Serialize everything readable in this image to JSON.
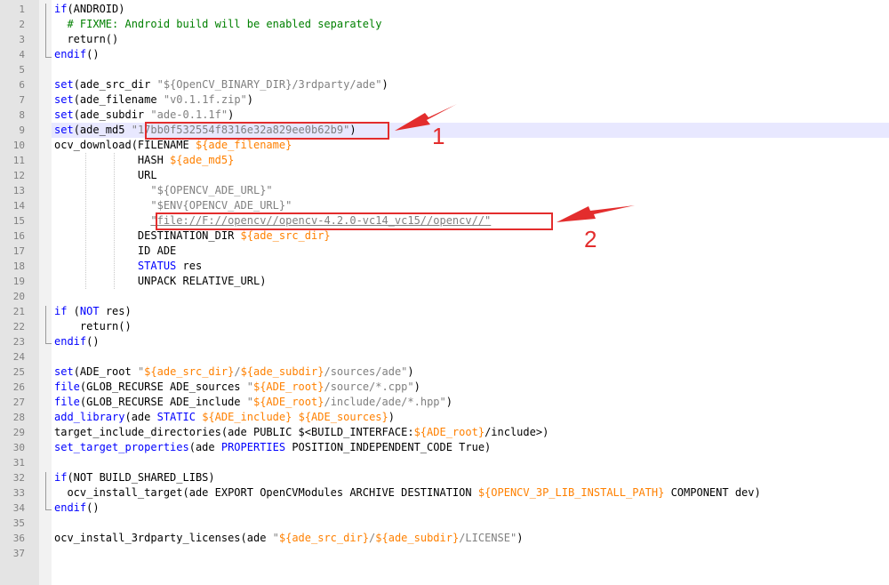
{
  "editor": {
    "line_numbers": [
      "1",
      "2",
      "3",
      "4",
      "5",
      "6",
      "7",
      "8",
      "9",
      "10",
      "11",
      "12",
      "13",
      "14",
      "15",
      "16",
      "17",
      "18",
      "19",
      "20",
      "21",
      "22",
      "23",
      "24",
      "25",
      "26",
      "27",
      "28",
      "29",
      "30",
      "31",
      "32",
      "33",
      "34",
      "35",
      "36",
      "37"
    ],
    "lines": [
      [
        {
          "t": "if",
          "c": "kw"
        },
        {
          "t": "(ANDROID)"
        }
      ],
      [
        {
          "t": "  # FIXME: Android build will be enabled separately",
          "c": "cm"
        }
      ],
      [
        {
          "t": "  return()"
        }
      ],
      [
        {
          "t": "endif",
          "c": "kw"
        },
        {
          "t": "()"
        }
      ],
      [],
      [
        {
          "t": "set",
          "c": "kw"
        },
        {
          "t": "(ade_src_dir "
        },
        {
          "t": "\"${OpenCV_BINARY_DIR}/3rdparty/ade\"",
          "c": "str"
        },
        {
          "t": ")"
        }
      ],
      [
        {
          "t": "set",
          "c": "kw"
        },
        {
          "t": "(ade_filename "
        },
        {
          "t": "\"v0.1.1f.zip\"",
          "c": "str"
        },
        {
          "t": ")"
        }
      ],
      [
        {
          "t": "set",
          "c": "kw"
        },
        {
          "t": "(ade_subdir "
        },
        {
          "t": "\"ade-0.1.1f\"",
          "c": "str"
        },
        {
          "t": ")"
        }
      ],
      [
        {
          "t": "set",
          "c": "kw"
        },
        {
          "t": "(ade_md5 "
        },
        {
          "t": "\"17bb0f532554f8316e32a829ee0b62b9\"",
          "c": "str"
        },
        {
          "t": ")"
        }
      ],
      [
        {
          "t": "ocv_download(FILENAME "
        },
        {
          "t": "${ade_filename}",
          "c": "var"
        }
      ],
      [
        {
          "t": "             HASH "
        },
        {
          "t": "${ade_md5}",
          "c": "var"
        }
      ],
      [
        {
          "t": "             URL"
        }
      ],
      [
        {
          "t": "               "
        },
        {
          "t": "\"${OPENCV_ADE_URL}\"",
          "c": "str"
        }
      ],
      [
        {
          "t": "               "
        },
        {
          "t": "\"$ENV{OPENCV_ADE_URL}\"",
          "c": "str"
        }
      ],
      [
        {
          "t": "               "
        },
        {
          "t": "\"file://F://opencv//opencv-4.2.0-vc14_vc15//opencv//\"",
          "c": "str ul"
        }
      ],
      [
        {
          "t": "             DESTINATION_DIR "
        },
        {
          "t": "${ade_src_dir}",
          "c": "var"
        }
      ],
      [
        {
          "t": "             ID ADE"
        }
      ],
      [
        {
          "t": "             "
        },
        {
          "t": "STATUS",
          "c": "kw"
        },
        {
          "t": " res"
        }
      ],
      [
        {
          "t": "             UNPACK RELATIVE_URL)"
        }
      ],
      [],
      [
        {
          "t": "if",
          "c": "kw"
        },
        {
          "t": " ("
        },
        {
          "t": "NOT",
          "c": "kw"
        },
        {
          "t": " res)"
        }
      ],
      [
        {
          "t": "    return()"
        }
      ],
      [
        {
          "t": "endif",
          "c": "kw"
        },
        {
          "t": "()"
        }
      ],
      [],
      [
        {
          "t": "set",
          "c": "kw"
        },
        {
          "t": "(ADE_root "
        },
        {
          "t": "\"",
          "c": "str"
        },
        {
          "t": "${ade_src_dir}",
          "c": "var"
        },
        {
          "t": "/",
          "c": "str"
        },
        {
          "t": "${ade_subdir}",
          "c": "var"
        },
        {
          "t": "/sources/ade\"",
          "c": "str"
        },
        {
          "t": ")"
        }
      ],
      [
        {
          "t": "file",
          "c": "kw"
        },
        {
          "t": "(GLOB_RECURSE ADE_sources "
        },
        {
          "t": "\"",
          "c": "str"
        },
        {
          "t": "${ADE_root}",
          "c": "var"
        },
        {
          "t": "/source/*.cpp\"",
          "c": "str"
        },
        {
          "t": ")"
        }
      ],
      [
        {
          "t": "file",
          "c": "kw"
        },
        {
          "t": "(GLOB_RECURSE ADE_include "
        },
        {
          "t": "\"",
          "c": "str"
        },
        {
          "t": "${ADE_root}",
          "c": "var"
        },
        {
          "t": "/include/ade/*.hpp\"",
          "c": "str"
        },
        {
          "t": ")"
        }
      ],
      [
        {
          "t": "add_library",
          "c": "kw"
        },
        {
          "t": "(ade "
        },
        {
          "t": "STATIC",
          "c": "kw"
        },
        {
          "t": " "
        },
        {
          "t": "${ADE_include}",
          "c": "var"
        },
        {
          "t": " "
        },
        {
          "t": "${ADE_sources}",
          "c": "var"
        },
        {
          "t": ")"
        }
      ],
      [
        {
          "t": "target_include_directories(ade PUBLIC $<BUILD_INTERFACE:"
        },
        {
          "t": "${ADE_root}",
          "c": "var"
        },
        {
          "t": "/include>)"
        }
      ],
      [
        {
          "t": "set_target_properties",
          "c": "kw"
        },
        {
          "t": "(ade "
        },
        {
          "t": "PROPERTIES",
          "c": "kw"
        },
        {
          "t": " POSITION_INDEPENDENT_CODE True)"
        }
      ],
      [],
      [
        {
          "t": "if",
          "c": "kw"
        },
        {
          "t": "(NOT BUILD_SHARED_LIBS)"
        }
      ],
      [
        {
          "t": "  ocv_install_target(ade EXPORT OpenCVModules ARCHIVE DESTINATION "
        },
        {
          "t": "${OPENCV_3P_LIB_INSTALL_PATH}",
          "c": "var"
        },
        {
          "t": " COMPONENT dev)"
        }
      ],
      [
        {
          "t": "endif",
          "c": "kw"
        },
        {
          "t": "()"
        }
      ],
      [],
      [
        {
          "t": "ocv_install_3rdparty_licenses(ade "
        },
        {
          "t": "\"",
          "c": "str"
        },
        {
          "t": "${ade_src_dir}",
          "c": "var"
        },
        {
          "t": "/",
          "c": "str"
        },
        {
          "t": "${ade_subdir}",
          "c": "var"
        },
        {
          "t": "/LICENSE\"",
          "c": "str"
        },
        {
          "t": ")"
        }
      ],
      []
    ]
  },
  "annotations": {
    "marker_1": "1",
    "marker_2": "2",
    "color": "#e32d2d"
  }
}
